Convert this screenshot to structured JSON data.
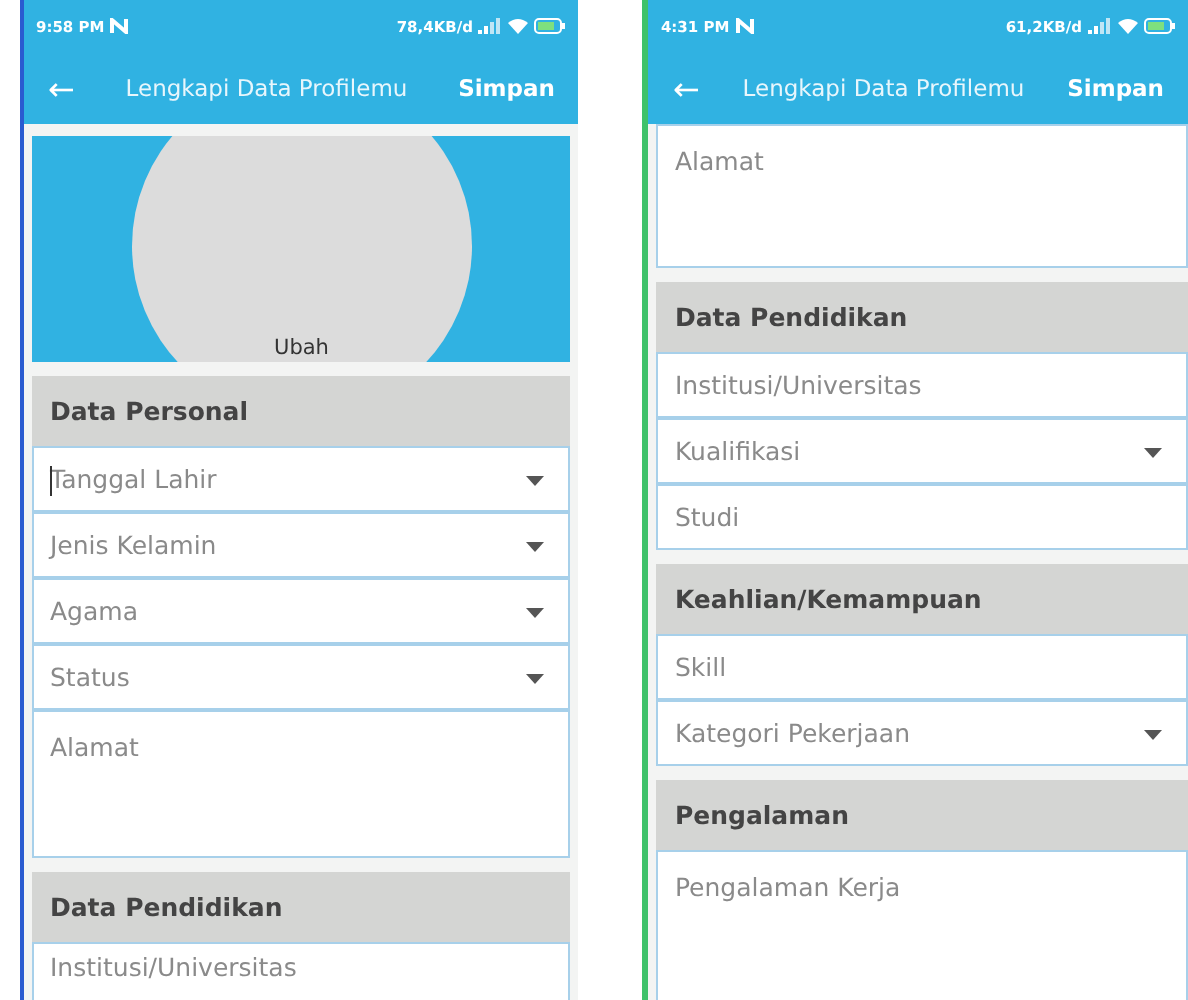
{
  "phones": [
    {
      "status_bar": {
        "time": "9:58 PM",
        "network_speed": "78,4KB/d"
      },
      "app_bar": {
        "back": "←",
        "title": "Lengkapi Data Profilemu",
        "action": "Simpan"
      },
      "content": [
        {
          "kind": "avatar",
          "label": "Ubah"
        },
        {
          "kind": "header",
          "label": "Data Personal"
        },
        {
          "kind": "dropdown",
          "placeholder": "Tanggal Lahir",
          "focused": true
        },
        {
          "kind": "dropdown",
          "placeholder": "Jenis Kelamin",
          "focused": false
        },
        {
          "kind": "dropdown",
          "placeholder": "Agama",
          "focused": false
        },
        {
          "kind": "dropdown",
          "placeholder": "Status",
          "focused": false
        },
        {
          "kind": "textarea",
          "placeholder": "Alamat",
          "focused": false
        },
        {
          "kind": "header",
          "label": "Data Pendidikan"
        },
        {
          "kind": "text",
          "placeholder": "Institusi/Universitas",
          "focused": false
        }
      ]
    },
    {
      "status_bar": {
        "time": "4:31 PM",
        "network_speed": "61,2KB/d"
      },
      "app_bar": {
        "back": "←",
        "title": "Lengkapi Data Profilemu",
        "action": "Simpan"
      },
      "content": [
        {
          "kind": "textarea",
          "placeholder": "Alamat",
          "focused": false
        },
        {
          "kind": "header",
          "label": "Data Pendidikan"
        },
        {
          "kind": "text",
          "placeholder": "Institusi/Universitas",
          "focused": false
        },
        {
          "kind": "dropdown",
          "placeholder": "Kualifikasi",
          "focused": false
        },
        {
          "kind": "text",
          "placeholder": "Studi",
          "focused": false
        },
        {
          "kind": "header",
          "label": "Keahlian/Kemampuan"
        },
        {
          "kind": "text",
          "placeholder": "Skill",
          "focused": false
        },
        {
          "kind": "dropdown",
          "placeholder": "Kategori Pekerjaan",
          "focused": false
        },
        {
          "kind": "header",
          "label": "Pengalaman"
        },
        {
          "kind": "textarea",
          "placeholder": "Pengalaman Kerja",
          "focused": false
        }
      ]
    }
  ]
}
